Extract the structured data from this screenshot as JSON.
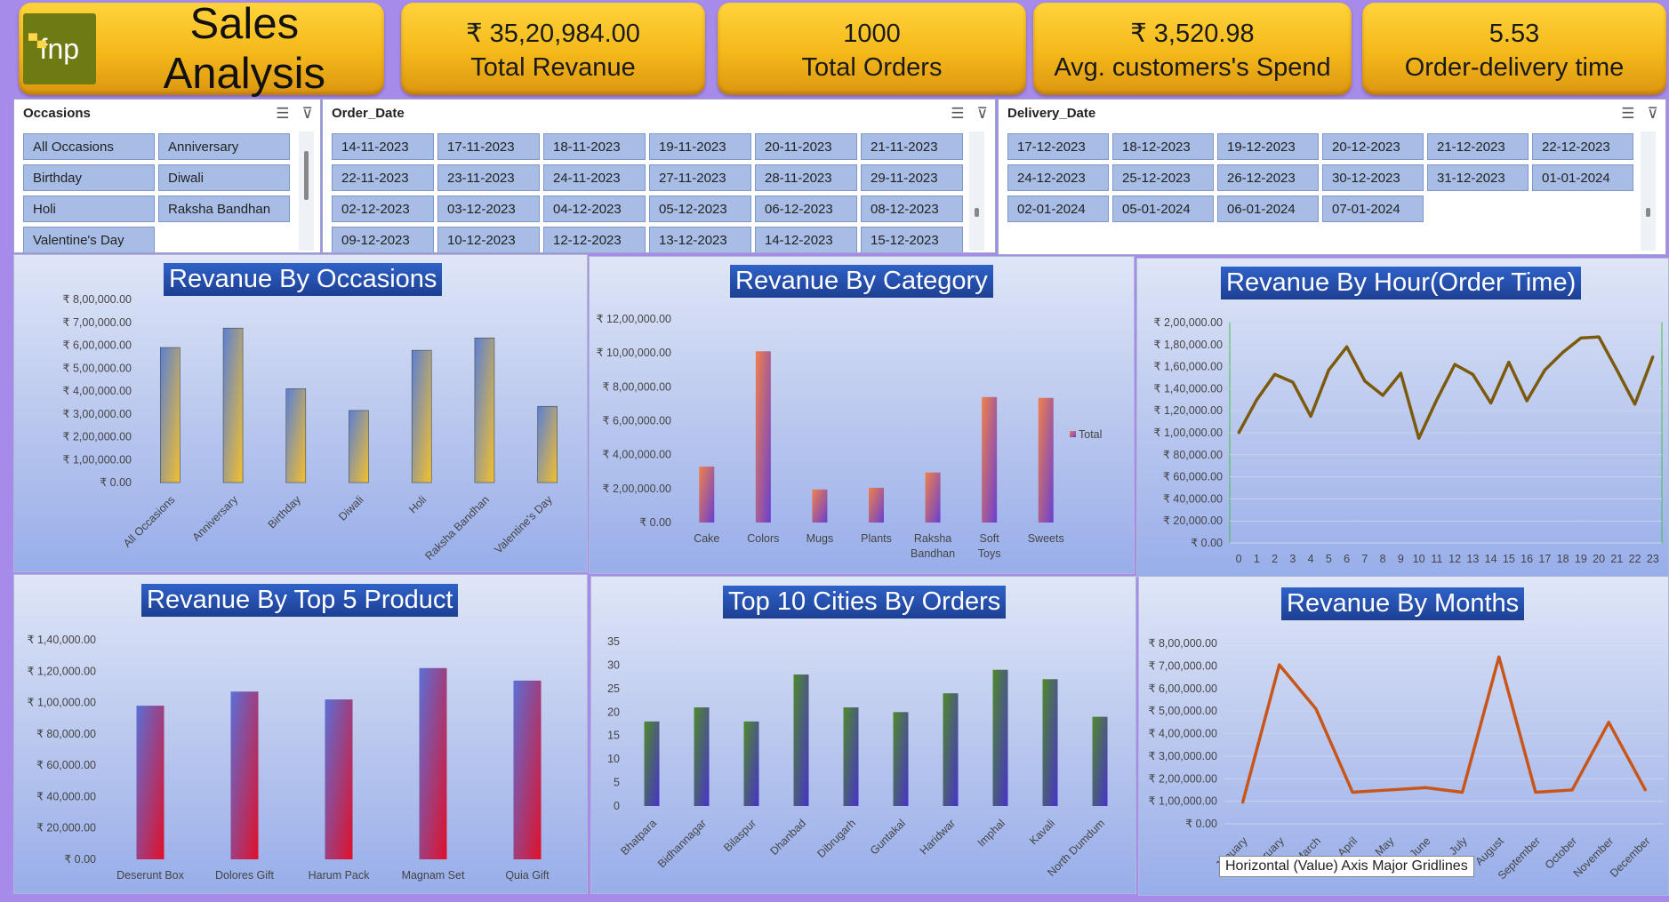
{
  "brand": {
    "logo_text": "fnp",
    "title": "Sales Analysis"
  },
  "kpis": [
    {
      "value": "₹ 35,20,984.00",
      "label": "Total Revanue"
    },
    {
      "value": "1000",
      "label": "Total Orders"
    },
    {
      "value": "₹ 3,520.98",
      "label": "Avg. customers's Spend"
    },
    {
      "value": "5.53",
      "label": "Order-delivery time"
    }
  ],
  "slicers": {
    "occasions": {
      "title": "Occasions",
      "items": [
        "All Occasions",
        "Anniversary",
        "Birthday",
        "Diwali",
        "Holi",
        "Raksha Bandhan",
        "Valentine's Day"
      ]
    },
    "order_date": {
      "title": "Order_Date",
      "items": [
        "14-11-2023",
        "17-11-2023",
        "18-11-2023",
        "19-11-2023",
        "20-11-2023",
        "21-11-2023",
        "22-11-2023",
        "23-11-2023",
        "24-11-2023",
        "27-11-2023",
        "28-11-2023",
        "29-11-2023",
        "02-12-2023",
        "03-12-2023",
        "04-12-2023",
        "05-12-2023",
        "06-12-2023",
        "08-12-2023",
        "09-12-2023",
        "10-12-2023",
        "12-12-2023",
        "13-12-2023",
        "14-12-2023",
        "15-12-2023"
      ]
    },
    "delivery_date": {
      "title": "Delivery_Date",
      "items": [
        "17-12-2023",
        "18-12-2023",
        "19-12-2023",
        "20-12-2023",
        "21-12-2023",
        "22-12-2023",
        "24-12-2023",
        "25-12-2023",
        "26-12-2023",
        "30-12-2023",
        "31-12-2023",
        "01-01-2024",
        "02-01-2024",
        "05-01-2024",
        "06-01-2024",
        "07-01-2024"
      ]
    }
  },
  "tooltip": "Horizontal (Value) Axis Major Gridlines",
  "chart_data": [
    {
      "id": "occasions",
      "type": "bar",
      "title": "Revanue By Occasions",
      "categories": [
        "All Occasions",
        "Anniversary",
        "Birthday",
        "Diwali",
        "Holi",
        "Raksha Bandhan",
        "Valentine's Day"
      ],
      "values": [
        590000,
        675000,
        410000,
        315000,
        578000,
        632000,
        333000
      ],
      "ylim": [
        0,
        800000
      ],
      "yticks": [
        "₹ 0.00",
        "₹ 1,00,000.00",
        "₹ 2,00,000.00",
        "₹ 3,00,000.00",
        "₹ 4,00,000.00",
        "₹ 5,00,000.00",
        "₹ 6,00,000.00",
        "₹ 7,00,000.00",
        "₹ 8,00,000.00"
      ],
      "colors": [
        "#5b7fd6",
        "#f4c02c"
      ]
    },
    {
      "id": "category",
      "type": "bar",
      "title": "Revanue By Category",
      "categories": [
        "Cake",
        "Colors",
        "Mugs",
        "Plants",
        "Raksha Bandhan",
        "Soft Toys",
        "Sweets"
      ],
      "values": [
        330000,
        1010000,
        195000,
        205000,
        295000,
        740000,
        735000
      ],
      "ylim": [
        0,
        1200000
      ],
      "yticks": [
        "₹ 0.00",
        "₹ 2,00,000.00",
        "₹ 4,00,000.00",
        "₹ 6,00,000.00",
        "₹ 8,00,000.00",
        "₹ 10,00,000.00",
        "₹ 12,00,000.00"
      ],
      "legend": "Total",
      "colors": [
        "#f0804a",
        "#6a3fd1"
      ]
    },
    {
      "id": "hour",
      "type": "line",
      "title": "Revanue By Hour(Order Time)",
      "categories": [
        "0",
        "1",
        "2",
        "3",
        "4",
        "5",
        "6",
        "7",
        "8",
        "9",
        "10",
        "11",
        "12",
        "13",
        "14",
        "15",
        "16",
        "17",
        "18",
        "19",
        "20",
        "21",
        "22",
        "23"
      ],
      "values": [
        100000,
        130000,
        153000,
        146000,
        115000,
        157000,
        178000,
        147000,
        134000,
        154000,
        95000,
        130000,
        162000,
        153000,
        127000,
        164000,
        129000,
        157000,
        173000,
        186000,
        187000,
        157000,
        126000,
        169000
      ],
      "ylim": [
        0,
        200000
      ],
      "yticks": [
        "₹ 0.00",
        "₹ 20,000.00",
        "₹ 40,000.00",
        "₹ 60,000.00",
        "₹ 80,000.00",
        "₹ 1,00,000.00",
        "₹ 1,20,000.00",
        "₹ 1,40,000.00",
        "₹ 1,60,000.00",
        "₹ 1,80,000.00",
        "₹ 2,00,000.00"
      ],
      "colors": [
        "#7b5a0c"
      ]
    },
    {
      "id": "products",
      "type": "bar",
      "title": "Revanue By Top 5 Product",
      "categories": [
        "Deserunt Box",
        "Dolores Gift",
        "Harum Pack",
        "Magnam Set",
        "Quia Gift"
      ],
      "values": [
        98000,
        107000,
        102000,
        122000,
        114000
      ],
      "ylim": [
        0,
        140000
      ],
      "yticks": [
        "₹ 0.00",
        "₹ 20,000.00",
        "₹ 40,000.00",
        "₹ 60,000.00",
        "₹ 80,000.00",
        "₹ 1,00,000.00",
        "₹ 1,20,000.00",
        "₹ 1,40,000.00"
      ],
      "colors": [
        "#5b6fd6",
        "#e0102a"
      ]
    },
    {
      "id": "cities",
      "type": "bar",
      "title": "Top 10 Cities By Orders",
      "categories": [
        "Bhatpara",
        "Bidhannagar",
        "Bilaspur",
        "Dhanbad",
        "Dibrugarh",
        "Guntakal",
        "Haridwar",
        "Imphal",
        "Kavali",
        "North Dumdum"
      ],
      "values": [
        18,
        21,
        18,
        28,
        21,
        20,
        24,
        29,
        27,
        19
      ],
      "ylim": [
        0,
        35
      ],
      "yticks": [
        "0",
        "5",
        "10",
        "15",
        "20",
        "25",
        "30",
        "35"
      ],
      "colors": [
        "#4f8a2a",
        "#4732c9"
      ]
    },
    {
      "id": "months",
      "type": "line",
      "title": "Revanue By Months",
      "categories": [
        "January",
        "February",
        "March",
        "April",
        "May",
        "June",
        "July",
        "August",
        "September",
        "October",
        "November",
        "December"
      ],
      "values": [
        95000,
        705000,
        510000,
        140000,
        150000,
        160000,
        140000,
        740000,
        140000,
        150000,
        450000,
        150000
      ],
      "ylim": [
        0,
        800000
      ],
      "yticks": [
        "₹ 0.00",
        "₹ 1,00,000.00",
        "₹ 2,00,000.00",
        "₹ 3,00,000.00",
        "₹ 4,00,000.00",
        "₹ 5,00,000.00",
        "₹ 6,00,000.00",
        "₹ 7,00,000.00",
        "₹ 8,00,000.00"
      ],
      "colors": [
        "#c8561a"
      ]
    }
  ]
}
